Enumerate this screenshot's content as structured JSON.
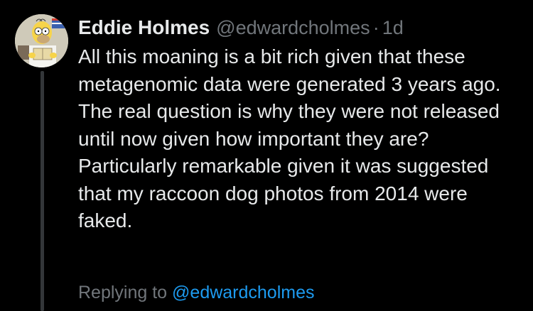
{
  "colors": {
    "background": "#000000",
    "text_primary": "#e7e9ea",
    "text_secondary": "#71767b",
    "link": "#1d9bf0",
    "thread_line": "#333639"
  },
  "tweet": {
    "avatar_icon": "user-avatar-cartoon",
    "display_name": "Eddie Holmes",
    "handle": "@edwardcholmes",
    "separator": "·",
    "timestamp": "1d",
    "text": "All this moaning is a bit rich given that these metagenomic data were generated 3 years ago. The real question is why they were not released until now given how important they are? Particularly remarkable given it was suggested that my raccoon dog photos from 2014 were faked."
  },
  "reply_context": {
    "prefix": "Replying to",
    "mention": "@edwardcholmes"
  }
}
